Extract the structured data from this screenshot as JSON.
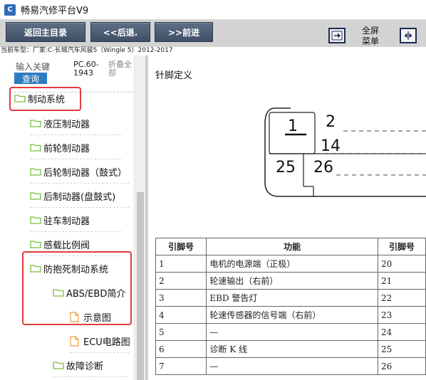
{
  "window": {
    "title": "畅易汽修平台V9",
    "app_icon_letter": "C"
  },
  "toolbar": {
    "home_label": "返回主目录",
    "back_label": "<<后退.",
    "forward_label": ">>前进",
    "fullscreen_label": "全屏",
    "menu_label": "菜单"
  },
  "car_model": "当前车型：厂家:C-长城汽车风骏5（Wingle 5）2012-2017",
  "left": {
    "search_hint": "输入关键",
    "query_label": "查询",
    "pc_line1": "PC.60-",
    "pc_line2": "1943",
    "fold_line1": "折叠全",
    "fold_line2": "部"
  },
  "tree": [
    {
      "label": "制动系统",
      "type": "folder",
      "level": 0
    },
    {
      "label": "液压制动器",
      "type": "folder",
      "level": 1
    },
    {
      "label": "前轮制动器",
      "type": "folder",
      "level": 1
    },
    {
      "label": "后轮制动器（鼓式）",
      "type": "folder",
      "level": 1
    },
    {
      "label": "后制动器(盘鼓式)",
      "type": "folder",
      "level": 1
    },
    {
      "label": "驻车制动器",
      "type": "folder",
      "level": 1
    },
    {
      "label": "感载比例阀",
      "type": "folder",
      "level": 1
    },
    {
      "label": "防抱死制动系统",
      "type": "folder",
      "level": 1
    },
    {
      "label": "ABS/EBD简介",
      "type": "folder",
      "level": 2
    },
    {
      "label": "示意图",
      "type": "doc",
      "level": 3
    },
    {
      "label": "ECU电路图",
      "type": "doc",
      "level": 3
    },
    {
      "label": "故障诊断",
      "type": "folder",
      "level": 2
    }
  ],
  "content": {
    "pin_title": "针脚定义",
    "connector_pins": {
      "p1": "1",
      "p2": "2",
      "p14": "14",
      "p25": "25",
      "p26": "26"
    },
    "table": {
      "headers": [
        "引脚号",
        "功能",
        "引脚号"
      ],
      "rows": [
        [
          "1",
          "电机的电源端（正极）",
          "20"
        ],
        [
          "2",
          "轮速输出（右前）",
          "21"
        ],
        [
          "3",
          "EBD 警告灯",
          "22"
        ],
        [
          "4",
          "轮速传感器的信号端（右前）",
          "23"
        ],
        [
          "5",
          "—",
          "24"
        ],
        [
          "6",
          "诊断 K 线",
          "25"
        ],
        [
          "7",
          "—",
          "26"
        ]
      ]
    }
  },
  "colors": {
    "toolbar_button": "#4b5b72",
    "query_button": "#2d7cc1",
    "highlight_box": "#e23b3b",
    "folder": "#7cbd3e"
  }
}
